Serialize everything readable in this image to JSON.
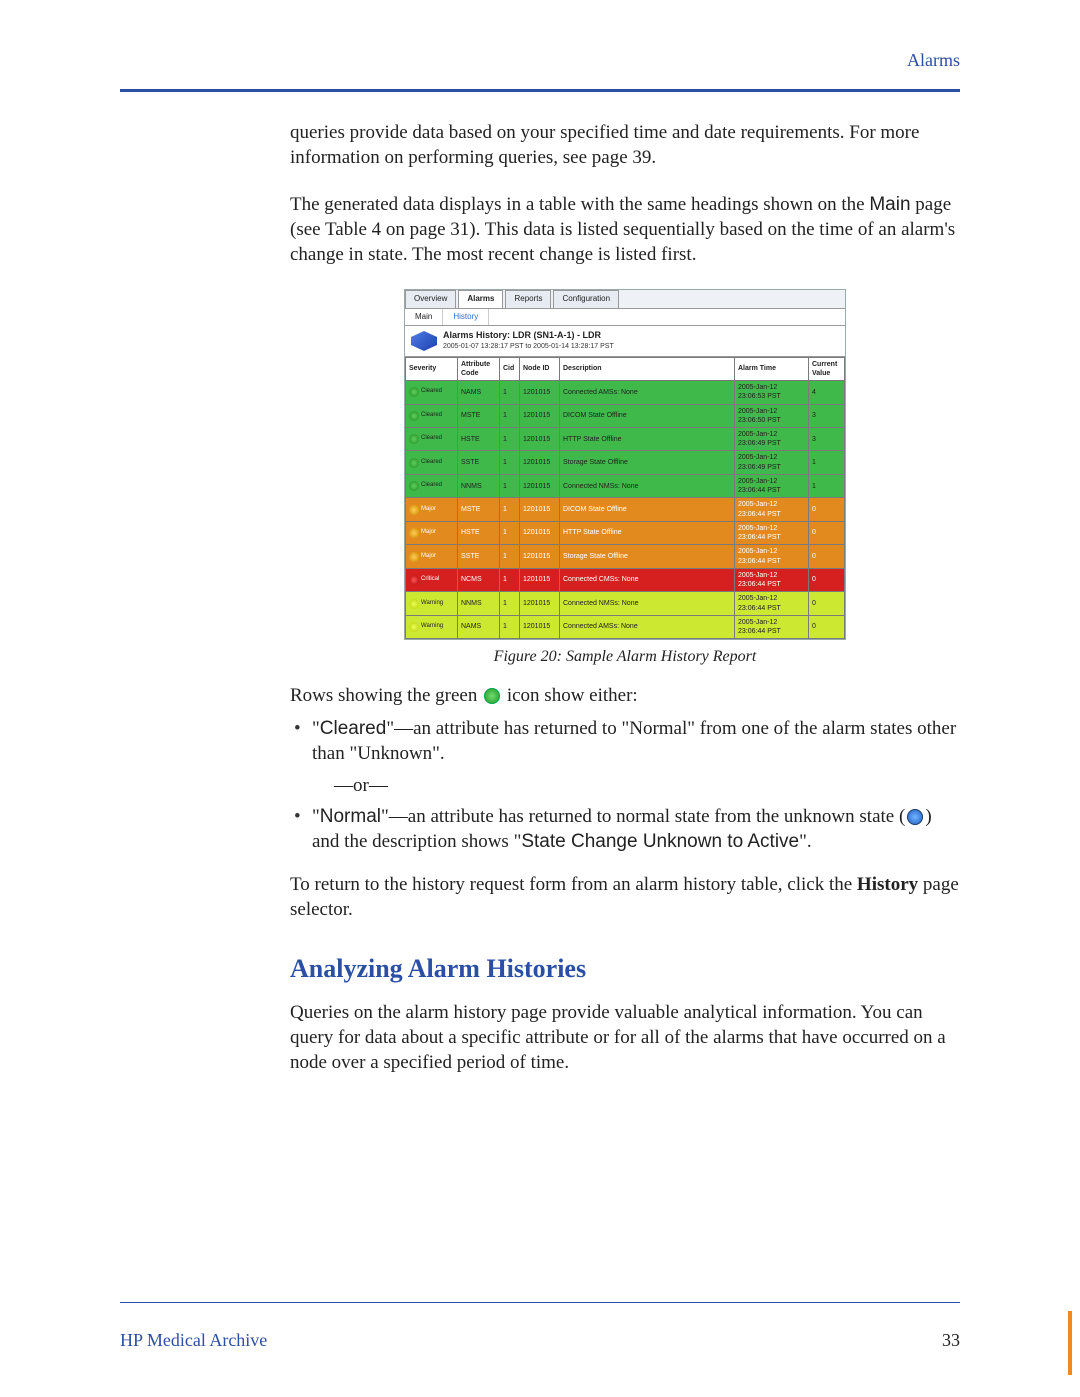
{
  "header": {
    "section": "Alarms"
  },
  "intro": {
    "para1": "queries provide data based on your specified time and date requirements. For more information on performing queries, see page 39.",
    "para2_a": "The generated data displays in a table with the same headings shown on the ",
    "para2_main": "Main",
    "para2_b": " page (see Table 4 on page 31). This data is listed sequentially based on the time of an alarm's change in state. The most recent change is listed first."
  },
  "figure": {
    "caption": "Figure 20: Sample Alarm History Report",
    "tabs": [
      "Overview",
      "Alarms",
      "Reports",
      "Configuration"
    ],
    "subtabs": [
      "Main",
      "History"
    ],
    "title": "Alarms History: LDR (SN1-A-1) - LDR",
    "subtitle": "2005-01-07 13:28:17 PST to 2005-01-14 13:28:17 PST",
    "columns": [
      "Severity",
      "Attribute Code",
      "Cid",
      "Node ID",
      "Description",
      "Alarm Time",
      "Current Value"
    ],
    "rows": [
      {
        "sev": "Cleared",
        "sevClass": "cleared",
        "rowClass": "green",
        "attr": "NAMS",
        "cid": "1",
        "node": "1201015",
        "desc": "Connected AMSs: None",
        "time": "2005-Jan-12 23:06:53 PST",
        "val": "4"
      },
      {
        "sev": "Cleared",
        "sevClass": "cleared",
        "rowClass": "green",
        "attr": "MSTE",
        "cid": "1",
        "node": "1201015",
        "desc": "DICOM State Offline",
        "time": "2005-Jan-12 23:06:50 PST",
        "val": "3"
      },
      {
        "sev": "Cleared",
        "sevClass": "cleared",
        "rowClass": "green",
        "attr": "HSTE",
        "cid": "1",
        "node": "1201015",
        "desc": "HTTP State Offline",
        "time": "2005-Jan-12 23:06:49 PST",
        "val": "3"
      },
      {
        "sev": "Cleared",
        "sevClass": "cleared",
        "rowClass": "green",
        "attr": "SSTE",
        "cid": "1",
        "node": "1201015",
        "desc": "Storage State Offline",
        "time": "2005-Jan-12 23:06:49 PST",
        "val": "1"
      },
      {
        "sev": "Cleared",
        "sevClass": "cleared",
        "rowClass": "green",
        "attr": "NNMS",
        "cid": "1",
        "node": "1201015",
        "desc": "Connected NMSs: None",
        "time": "2005-Jan-12 23:06:44 PST",
        "val": "1"
      },
      {
        "sev": "Major",
        "sevClass": "major",
        "rowClass": "orange",
        "attr": "MSTE",
        "cid": "1",
        "node": "1201015",
        "desc": "DICOM State Offline",
        "time": "2005-Jan-12 23:06:44 PST",
        "val": "0"
      },
      {
        "sev": "Major",
        "sevClass": "major",
        "rowClass": "orange",
        "attr": "HSTE",
        "cid": "1",
        "node": "1201015",
        "desc": "HTTP State Offline",
        "time": "2005-Jan-12 23:06:44 PST",
        "val": "0"
      },
      {
        "sev": "Major",
        "sevClass": "major",
        "rowClass": "orange",
        "attr": "SSTE",
        "cid": "1",
        "node": "1201015",
        "desc": "Storage State Offline",
        "time": "2005-Jan-12 23:06:44 PST",
        "val": "0"
      },
      {
        "sev": "Critical",
        "sevClass": "critical",
        "rowClass": "red",
        "attr": "NCMS",
        "cid": "1",
        "node": "1201015",
        "desc": "Connected CMSs: None",
        "time": "2005-Jan-12 23:06:44 PST",
        "val": "0"
      },
      {
        "sev": "Warning",
        "sevClass": "warning",
        "rowClass": "yellow",
        "attr": "NNMS",
        "cid": "1",
        "node": "1201015",
        "desc": "Connected NMSs: None",
        "time": "2005-Jan-12 23:06:44 PST",
        "val": "0"
      },
      {
        "sev": "Warning",
        "sevClass": "warning",
        "rowClass": "yellow",
        "attr": "NAMS",
        "cid": "1",
        "node": "1201015",
        "desc": "Connected AMSs: None",
        "time": "2005-Jan-12 23:06:44 PST",
        "val": "0"
      }
    ]
  },
  "after": {
    "rows_intro_a": "Rows showing the green ",
    "rows_intro_b": " icon show either:",
    "bullet1_a": "\"",
    "bullet1_cleared": "Cleared",
    "bullet1_b": "\"—an attribute has returned to \"Normal\" from one of the alarm states other than \"Unknown\".",
    "or": "—or—",
    "bullet2_a": "\"",
    "bullet2_normal": "Normal",
    "bullet2_b": "\"—an attribute has returned to normal state from the unknown state (",
    "bullet2_c": ") and the description shows \"",
    "bullet2_state": "State Change Unknown to Active",
    "bullet2_d": "\".",
    "return_a": "To return to the history request form from an alarm history table, click the ",
    "return_history": "History",
    "return_b": " page selector."
  },
  "analysis": {
    "title": "Analyzing Alarm Histories",
    "para": "Queries on the alarm history page provide valuable analytical information. You can query for data about a specific attribute or for all of the alarms that have occurred on a node over a specified period of time."
  },
  "footer": {
    "left": "HP Medical Archive",
    "page": "33"
  }
}
